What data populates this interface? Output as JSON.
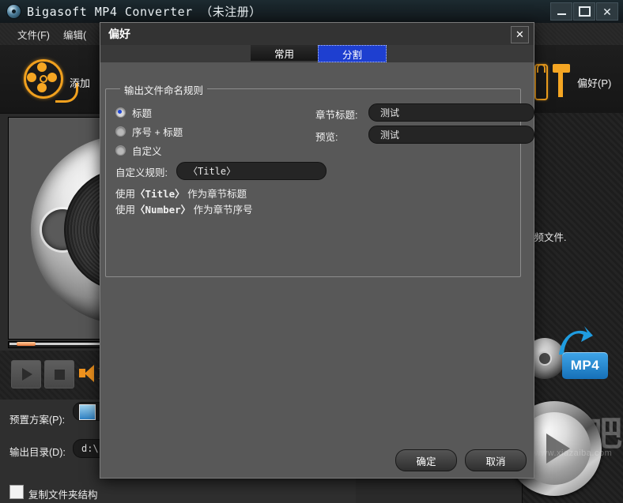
{
  "window": {
    "title": "Bigasoft MP4 Converter （未注册）",
    "logo_icon": "disc-icon",
    "controls": {
      "minimize": "minimize-icon",
      "maximize": "maximize-icon",
      "close": "✕"
    }
  },
  "menubar": {
    "items": [
      {
        "label": "文件(F)"
      },
      {
        "label": "编辑("
      }
    ]
  },
  "toolbar": {
    "add": {
      "icon": "film-reel-icon",
      "label": "添加"
    },
    "preferences": {
      "icon": "wrench-hammer-icon",
      "label": "偏好(P)"
    }
  },
  "preview": {
    "reel_icon": "film-reel-large-icon",
    "transport": {
      "play": "play-icon",
      "stop": "stop-icon",
      "volume": "speaker-icon"
    }
  },
  "bottom_form": {
    "preset_label": "预置方案(P):",
    "preset_icon": "preset-thumbnail-icon",
    "output_label": "输出目录(D):",
    "output_value": "d:\\",
    "copy_structure_label": "复制文件夹结构"
  },
  "right_panel": {
    "text": "视频文件.",
    "format_badge": "MP4",
    "disc_icon": "dvd-disc-icon",
    "arrow_icon": "curved-arrow-icon",
    "convert_button": "convert-play-button",
    "watermark_cn": "下载吧",
    "watermark_url": "www.xiazaiba.com"
  },
  "dialog": {
    "title": "偏好",
    "close_label": "✕",
    "tabs": [
      {
        "label": "常用",
        "active": false
      },
      {
        "label": "分割",
        "active": true
      }
    ],
    "group": {
      "title": "输出文件命名规则",
      "radios": [
        {
          "label": "标题",
          "selected": true
        },
        {
          "label": "序号 + 标题",
          "selected": false
        },
        {
          "label": "自定义",
          "selected": false
        }
      ],
      "custom_rule_label": "自定义规则:",
      "custom_rule_value": "〈Title〉",
      "hints": [
        {
          "prefix": "使用",
          "token": "〈Title〉",
          "suffix": " 作为章节标题"
        },
        {
          "prefix": "使用",
          "token": "〈Number〉",
          "suffix": " 作为章节序号"
        }
      ],
      "chapter_title_label": "章节标题:",
      "chapter_title_value": "测试",
      "preview_label": "预览:",
      "preview_value": "测试"
    },
    "buttons": {
      "ok": "确定",
      "cancel": "取消"
    }
  },
  "colors": {
    "accent_blue": "#1e3fd0",
    "accent_orange": "#f5a623",
    "dialog_bg": "#585858",
    "mp4_blue": "#1670b8"
  }
}
